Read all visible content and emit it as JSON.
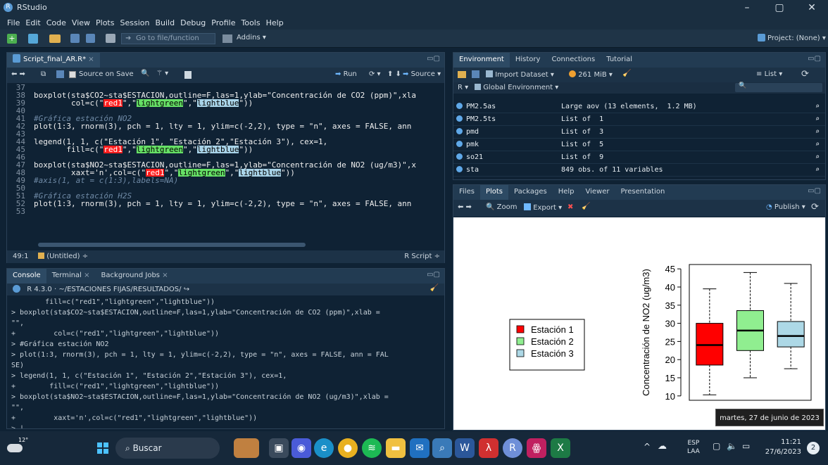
{
  "window": {
    "title": "RStudio",
    "minimize": "–",
    "maximize": "▢",
    "close": "✕"
  },
  "menu": [
    "File",
    "Edit",
    "Code",
    "View",
    "Plots",
    "Session",
    "Build",
    "Debug",
    "Profile",
    "Tools",
    "Help"
  ],
  "toolbar": {
    "goto_placeholder": "Go to file/function",
    "addins": "Addins",
    "project": "Project: (None)"
  },
  "editor": {
    "tab": "Script_final_AR.R*",
    "source_on_save": "Source on Save",
    "run": "Run",
    "source": "Source",
    "status_pos": "49:1",
    "status_scope": "(Untitled)",
    "status_type": "R Script",
    "lines": [
      {
        "n": "37",
        "segs": []
      },
      {
        "n": "38",
        "segs": [
          {
            "t": "boxplot(sta$CO2~sta$ESTACION,outline=F,las=1,ylab=\"Concentración de CO2 (ppm)\",xla",
            "c": ""
          }
        ]
      },
      {
        "n": "39",
        "segs": [
          {
            "t": "        col=c(\"",
            "c": ""
          },
          {
            "t": "red1",
            "c": "hlr"
          },
          {
            "t": "\",\"",
            "c": ""
          },
          {
            "t": "lightgreen",
            "c": "hlg"
          },
          {
            "t": "\",\"",
            "c": ""
          },
          {
            "t": "lightblue",
            "c": "hlb"
          },
          {
            "t": "\"))",
            "c": ""
          }
        ]
      },
      {
        "n": "40",
        "segs": []
      },
      {
        "n": "41",
        "segs": [
          {
            "t": "#Gráfica estación NO2",
            "c": "com"
          }
        ]
      },
      {
        "n": "42",
        "segs": [
          {
            "t": "plot(1:3, rnorm(3), pch = 1, lty = 1, ylim=c(-2,2), type = \"n\", axes = FALSE, ann",
            "c": ""
          }
        ]
      },
      {
        "n": "43",
        "segs": []
      },
      {
        "n": "44",
        "segs": [
          {
            "t": "legend(1, 1, c(\"Estación 1\", \"Estación 2\",\"Estación 3\"), cex=1,",
            "c": ""
          }
        ]
      },
      {
        "n": "45",
        "segs": [
          {
            "t": "       fill=c(\"",
            "c": ""
          },
          {
            "t": "red1",
            "c": "hlr"
          },
          {
            "t": "\",\"",
            "c": ""
          },
          {
            "t": "lightgreen",
            "c": "hlg"
          },
          {
            "t": "\",\"",
            "c": ""
          },
          {
            "t": "lightblue",
            "c": "hlb"
          },
          {
            "t": "\"))",
            "c": ""
          }
        ]
      },
      {
        "n": "46",
        "segs": []
      },
      {
        "n": "47",
        "segs": [
          {
            "t": "boxplot(sta$NO2~sta$ESTACION,outline=F,las=1,ylab=\"Concentración de NO2 (ug/m3)\",x",
            "c": ""
          }
        ]
      },
      {
        "n": "48",
        "segs": [
          {
            "t": "        xaxt='n',col=c(\"",
            "c": ""
          },
          {
            "t": "red1",
            "c": "hlr"
          },
          {
            "t": "\",\"",
            "c": ""
          },
          {
            "t": "lightgreen",
            "c": "hlg"
          },
          {
            "t": "\",\"",
            "c": ""
          },
          {
            "t": "lightblue",
            "c": "hlb"
          },
          {
            "t": "\"))",
            "c": ""
          }
        ]
      },
      {
        "n": "49",
        "segs": [
          {
            "t": "#axis(1, at = c(1:3),labels=NA)",
            "c": "com"
          }
        ]
      },
      {
        "n": "50",
        "segs": []
      },
      {
        "n": "51",
        "segs": [
          {
            "t": "#Gráfica estación H2S",
            "c": "com"
          }
        ]
      },
      {
        "n": "52",
        "segs": [
          {
            "t": "plot(1:3, rnorm(3), pch = 1, lty = 1, ylim=c(-2,2), type = \"n\", axes = FALSE, ann",
            "c": ""
          }
        ]
      },
      {
        "n": "53",
        "segs": []
      }
    ]
  },
  "console": {
    "tabs": [
      "Console",
      "Terminal",
      "Background Jobs"
    ],
    "rversion": "R 4.3.0",
    "path": "~/ESTACIONES FIJAS/RESULTADOS/",
    "lines": [
      "        fill=c(\"red1\",\"lightgreen\",\"lightblue\"))",
      "> boxplot(sta$CO2~sta$ESTACION,outline=F,las=1,ylab=\"Concentración de CO2 (ppm)\",xlab =",
      "\"\",",
      "+         col=c(\"red1\",\"lightgreen\",\"lightblue\"))",
      "> #Gráfica estación NO2",
      "> plot(1:3, rnorm(3), pch = 1, lty = 1, ylim=c(-2,2), type = \"n\", axes = FALSE, ann = FAL",
      "SE)",
      "> legend(1, 1, c(\"Estación 1\", \"Estación 2\",\"Estación 3\"), cex=1,",
      "+        fill=c(\"red1\",\"lightgreen\",\"lightblue\"))",
      "> boxplot(sta$NO2~sta$ESTACION,outline=F,las=1,ylab=\"Concentración de NO2 (ug/m3)\",xlab =",
      "\"\",",
      "+         xaxt='n',col=c(\"red1\",\"lightgreen\",\"lightblue\"))",
      "> |"
    ]
  },
  "environment": {
    "tabs": [
      "Environment",
      "History",
      "Connections",
      "Tutorial"
    ],
    "import": "Import Dataset",
    "memory": "261 MiB",
    "list_view": "List",
    "scope": "Global Environment",
    "rows": [
      {
        "name": "PM2.5as",
        "value": "Large aov (13 elements,  1.2 MB)"
      },
      {
        "name": "PM2.5ts",
        "value": "List of  1"
      },
      {
        "name": "pmd",
        "value": "List of  3"
      },
      {
        "name": "pmk",
        "value": "List of  5"
      },
      {
        "name": "so21",
        "value": "List of  9"
      },
      {
        "name": "sta",
        "value": "849 obs. of 11 variables"
      }
    ]
  },
  "files": {
    "tabs": [
      "Files",
      "Plots",
      "Packages",
      "Help",
      "Viewer",
      "Presentation"
    ],
    "zoom": "Zoom",
    "export": "Export",
    "publish": "Publish"
  },
  "chart_data": {
    "type": "boxplot",
    "ylabel": "Concentración de NO2 (ug/m3)",
    "ylim": [
      10,
      45
    ],
    "yticks": [
      10,
      15,
      20,
      25,
      30,
      35,
      40,
      45
    ],
    "legend": {
      "placement": "left",
      "entries": [
        "Estación 1",
        "Estación 2",
        "Estación 3"
      ]
    },
    "series": [
      {
        "name": "Estación 1",
        "color": "#ff0000",
        "min": 10.3,
        "q1": 18.5,
        "median": 24,
        "q3": 30,
        "max": 39.5
      },
      {
        "name": "Estación 2",
        "color": "#90ee90",
        "min": 15,
        "q1": 22.5,
        "median": 28,
        "q3": 33.5,
        "max": 44
      },
      {
        "name": "Estación 3",
        "color": "#add8e6",
        "min": 17.5,
        "q1": 23.5,
        "median": 26.5,
        "q3": 30.5,
        "max": 41
      }
    ]
  },
  "tooltip": "martes, 27 de junio de 2023",
  "taskbar": {
    "weather": "12°",
    "search": "Buscar",
    "lang1": "ESP",
    "lang2": "LAA",
    "time": "11:21",
    "date": "27/6/2023",
    "notif": "2"
  }
}
